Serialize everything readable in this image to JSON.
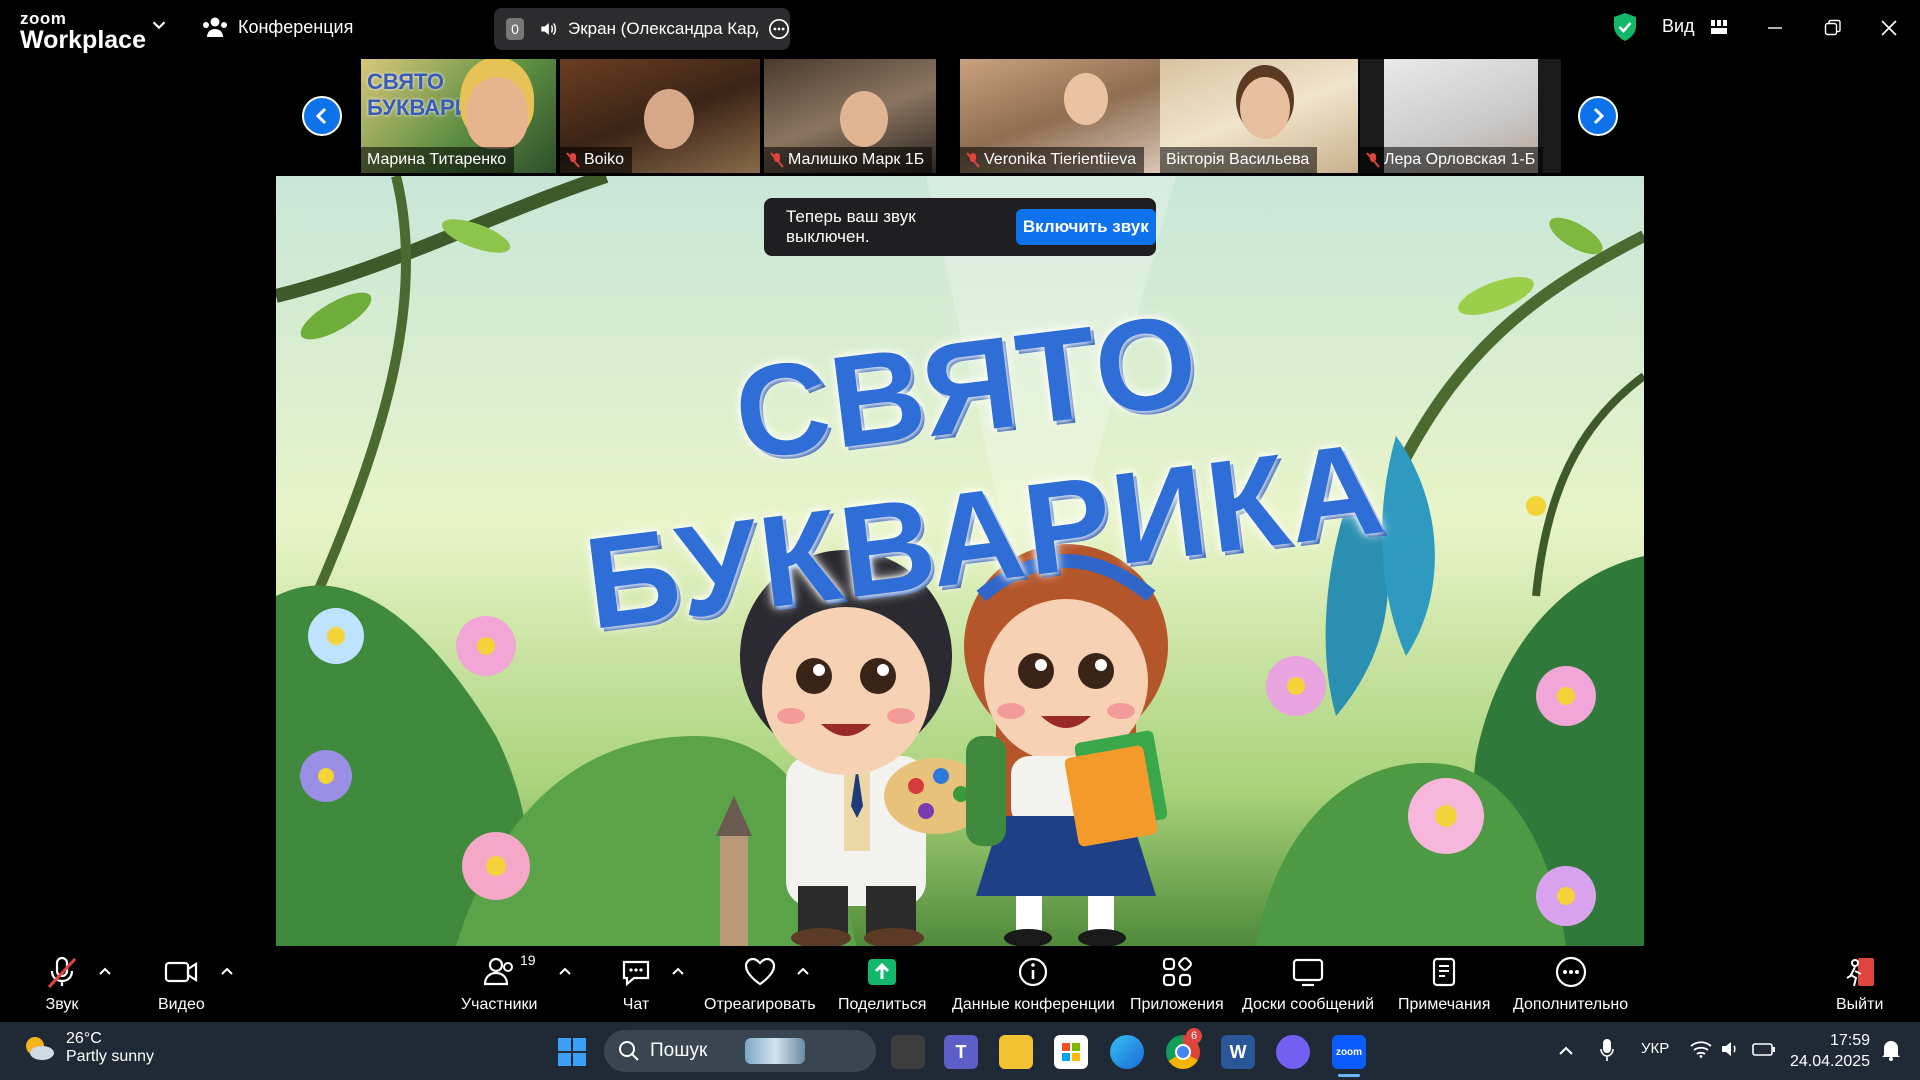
{
  "titlebar": {
    "logo_top": "zoom",
    "logo_bottom": "Workplace",
    "meeting_label": "Конференция",
    "share_badge": "0",
    "share_label": "Экран (Олександра Кардаш",
    "view_label": "Вид"
  },
  "participants": [
    {
      "name": "Марина Титаренко",
      "muted": false
    },
    {
      "name": "Boiko",
      "muted": true
    },
    {
      "name": "Малишко Марк 1Б",
      "muted": true
    },
    {
      "name": "Veronika Tierientiieva",
      "muted": true
    },
    {
      "name": "Вікторія Васильева",
      "muted": false
    },
    {
      "name": "Лера Орловская 1-Б",
      "muted": true
    }
  ],
  "slide": {
    "title": "СВЯТО БУКВАРИКА",
    "thumb_text": "СВЯТО БУКВАРИКА"
  },
  "toast": {
    "message": "Теперь ваш звук выключен.",
    "button": "Включить звук"
  },
  "toolbar": {
    "audio": "Звук",
    "video": "Видео",
    "participants": "Участники",
    "participants_count": "19",
    "chat": "Чат",
    "react": "Отреагировать",
    "share": "Поделиться",
    "info": "Данные конференции",
    "apps": "Приложения",
    "whiteboards": "Доски сообщений",
    "notes": "Примечания",
    "more": "Дополнительно",
    "leave": "Выйти"
  },
  "taskbar": {
    "temperature": "26°C",
    "weather": "Partly sunny",
    "search": "Пошук",
    "lang": "УКР",
    "time": "17:59",
    "date": "24.04.2025",
    "chrome_badge": "6"
  },
  "colors": {
    "accent": "#0e72ed",
    "title_blue": "#2f6ed6",
    "muted_red": "#e0443e",
    "shield_green": "#12b76a"
  }
}
